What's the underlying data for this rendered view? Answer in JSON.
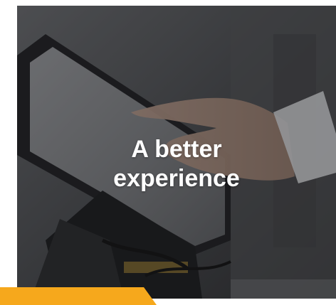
{
  "hero": {
    "headline_line1": "A better",
    "headline_line2": "experience",
    "image_subject": "hand-touching-pos-terminal-photo"
  },
  "colors": {
    "accent": "#f6a81c",
    "overlay": "#141416"
  },
  "icons": [
    "pos-terminal-illustration"
  ]
}
